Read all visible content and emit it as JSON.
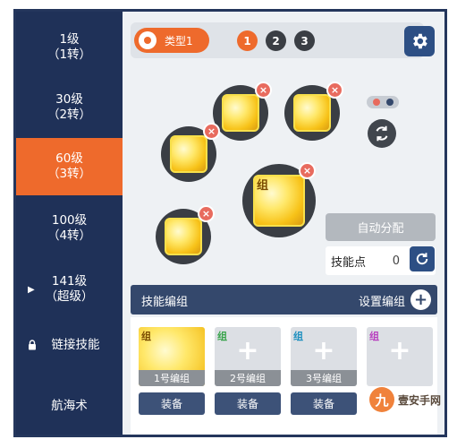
{
  "sidebar": {
    "items": [
      {
        "line1": "1级",
        "line2": "（1转）"
      },
      {
        "line1": "30级",
        "line2": "（2转）"
      },
      {
        "line1": "60级",
        "line2": "（3转）"
      },
      {
        "line1": "100级",
        "line2": "（4转）"
      },
      {
        "line1": "141级",
        "line2": "（超级）"
      },
      {
        "line1": "链接技能",
        "line2": ""
      },
      {
        "line1": "航海术",
        "line2": ""
      }
    ],
    "active_index": 2
  },
  "topbar": {
    "type_label": "类型1",
    "tabs": [
      "1",
      "2",
      "3"
    ],
    "active_tab": 0
  },
  "skills": {
    "slot_close": "×",
    "group_tag": "组"
  },
  "controls": {
    "auto_assign_label": "自动分配",
    "skill_points_label": "技能点",
    "skill_points_value": "0"
  },
  "group_section": {
    "title": "技能编组",
    "setup_label": "设置编组",
    "plus": "+",
    "slots": [
      {
        "name": "1号编组",
        "tag": "组",
        "equip": "装备"
      },
      {
        "name": "2号编组",
        "tag": "组",
        "equip": "装备"
      },
      {
        "name": "3号编组",
        "tag": "组",
        "equip": "装备"
      },
      {
        "name": "",
        "tag": "组",
        "equip": ""
      }
    ]
  },
  "watermark": {
    "logo": "九",
    "text": "壹安手网"
  },
  "colors": {
    "sidebar_bg": "#1f3158",
    "accent_orange": "#ee6a2c",
    "header_blue": "#2d4f84",
    "group_tag_colors": [
      "#7a4b00",
      "#38a34a",
      "#1d8fbf",
      "#b83fbf"
    ]
  }
}
